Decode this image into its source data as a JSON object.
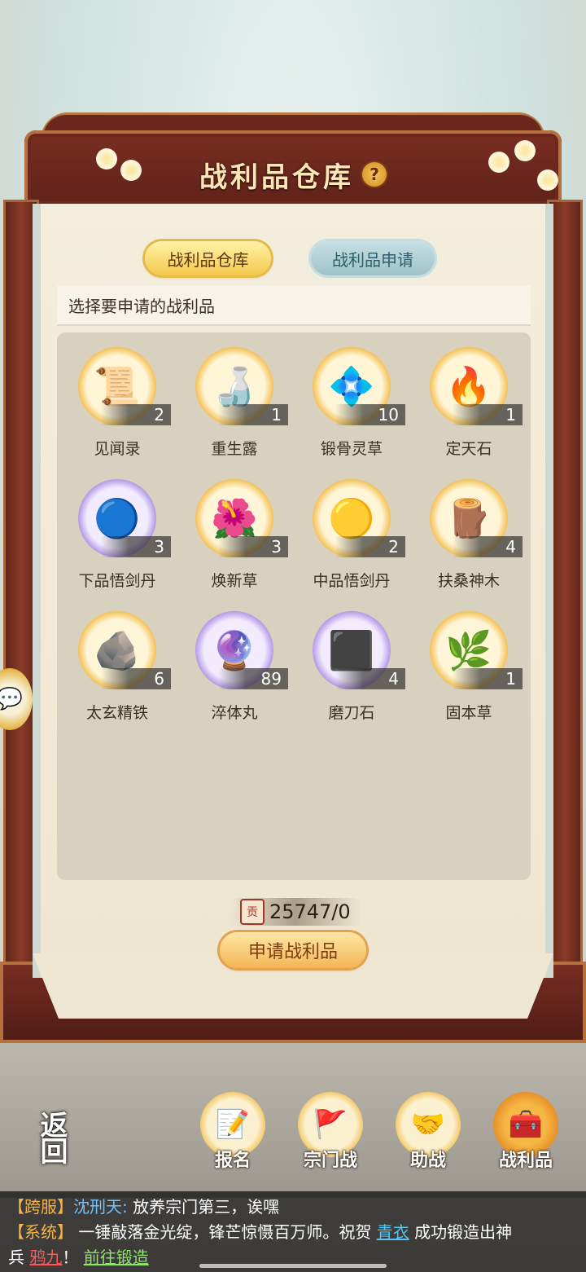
{
  "header": {
    "title": "战利品仓库",
    "help_icon": "?"
  },
  "tabs": [
    {
      "label": "战利品仓库",
      "active": true
    },
    {
      "label": "战利品申请",
      "active": false
    }
  ],
  "hint": "选择要申请的战利品",
  "items": [
    {
      "name": "见闻录",
      "count": "2",
      "icon": "scroll-book-icon",
      "glyph": "📜"
    },
    {
      "name": "重生露",
      "count": "1",
      "icon": "potion-bottle-icon",
      "glyph": "🍶"
    },
    {
      "name": "锻骨灵草",
      "count": "10",
      "icon": "blue-flower-icon",
      "glyph": "💠"
    },
    {
      "name": "定天石",
      "count": "1",
      "icon": "fire-stone-icon",
      "glyph": "🔥"
    },
    {
      "name": "下品悟剑丹",
      "count": "3",
      "icon": "cyan-pill-icon",
      "glyph": "🔵"
    },
    {
      "name": "焕新草",
      "count": "3",
      "icon": "blue-lily-icon",
      "glyph": "🌺"
    },
    {
      "name": "中品悟剑丹",
      "count": "2",
      "icon": "gold-pill-icon",
      "glyph": "🟡"
    },
    {
      "name": "扶桑神木",
      "count": "4",
      "icon": "wood-log-icon",
      "glyph": "🪵"
    },
    {
      "name": "太玄精铁",
      "count": "6",
      "icon": "iron-ore-icon",
      "glyph": "🪨"
    },
    {
      "name": "淬体丸",
      "count": "89",
      "icon": "chest-orb-icon",
      "glyph": "🔮"
    },
    {
      "name": "磨刀石",
      "count": "4",
      "icon": "whetstone-icon",
      "glyph": "⬛"
    },
    {
      "name": "固本草",
      "count": "1",
      "icon": "herb-icon",
      "glyph": "🌿"
    }
  ],
  "currency": {
    "icon_text": "贡",
    "value": "25747/0"
  },
  "apply_button": "申请战利品",
  "nav": {
    "back": "返回",
    "items": [
      {
        "label": "报名",
        "icon": "brush-document-icon",
        "glyph": "📝",
        "active": false
      },
      {
        "label": "宗门战",
        "icon": "flag-mountain-icon",
        "glyph": "🚩",
        "active": false
      },
      {
        "label": "助战",
        "icon": "handshake-icon",
        "glyph": "🤝",
        "active": false
      },
      {
        "label": "战利品",
        "icon": "treasure-chest-icon",
        "glyph": "🧰",
        "active": true
      }
    ]
  },
  "chat": {
    "line1": {
      "tag": "【跨服】",
      "name": "沈刑天:",
      "text": " 放养宗门第三，诶嘿"
    },
    "line2": {
      "tag": "【系统】",
      "text1": " 一锤敲落金光绽，锋芒惊慑百万师。祝贺 ",
      "player": "青衣",
      "text2": " 成功锻造出神"
    },
    "line3": {
      "text1": "兵 ",
      "weapon": "鸦九",
      "text2": "！  ",
      "link": "前往锻造"
    }
  },
  "colors": {
    "frame": "#6a271e",
    "accent_gold": "#f3b655",
    "scroll": "#f3eedd"
  }
}
